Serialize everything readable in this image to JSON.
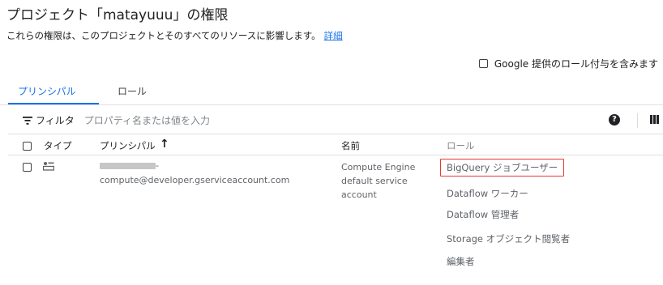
{
  "header": {
    "title": "プロジェクト「matayuuu」の権限",
    "subtitle": "これらの権限は、このプロジェクトとそのすべてのリソースに影響します。",
    "details_link": "詳細"
  },
  "google_roles_checkbox": {
    "label": "Google 提供のロール付与を含みます",
    "checked": false
  },
  "tabs": [
    {
      "label": "プリンシパル",
      "active": true
    },
    {
      "label": "ロール",
      "active": false
    }
  ],
  "filter": {
    "label": "フィルタ",
    "placeholder": "プロパティ名または値を入力"
  },
  "table": {
    "headers": {
      "type": "タイプ",
      "principal": "プリンシパル",
      "name": "名前",
      "role": "ロール"
    },
    "sort": {
      "column": "principal",
      "direction": "ascending"
    },
    "rows": [
      {
        "principal_prefix": "-",
        "principal_email": "compute@developer.gserviceaccount.com",
        "name": "Compute Engine default service account",
        "roles": [
          "BigQuery ジョブユーザー",
          "Dataflow ワーカー",
          "Dataflow 管理者",
          "Storage オブジェクト閲覧者",
          "編集者"
        ]
      }
    ]
  },
  "icons": {
    "filter": "filter-icon",
    "help": "help-icon",
    "columns": "column-display-icon",
    "sort": "arrow-up-icon",
    "service_account": "service-account-icon"
  },
  "colors": {
    "accent": "#1a73e8",
    "highlight_border": "#e53935"
  }
}
